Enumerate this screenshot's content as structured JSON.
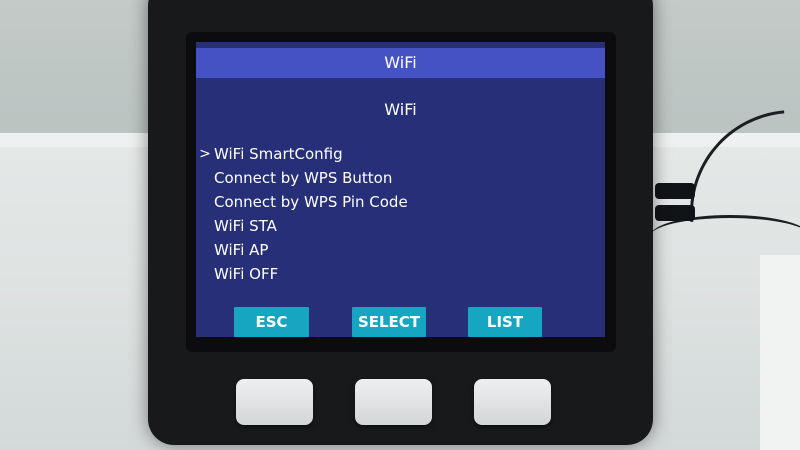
{
  "screen": {
    "title": "WiFi",
    "heading": "WiFi",
    "cursor_glyph": ">",
    "menu_items": [
      {
        "label": "WiFi SmartConfig",
        "selected": true
      },
      {
        "label": "Connect by WPS Button",
        "selected": false
      },
      {
        "label": "Connect by WPS Pin Code",
        "selected": false
      },
      {
        "label": "WiFi STA",
        "selected": false
      },
      {
        "label": "WiFi AP",
        "selected": false
      },
      {
        "label": "WiFi OFF",
        "selected": false
      }
    ],
    "softkeys": {
      "esc": "ESC",
      "select": "SELECT",
      "list": "LIST"
    }
  },
  "colors": {
    "screen_background": "#262f78",
    "title_bar": "#4552c4",
    "softkey": "#17a6c2",
    "text": "#ffffff"
  }
}
